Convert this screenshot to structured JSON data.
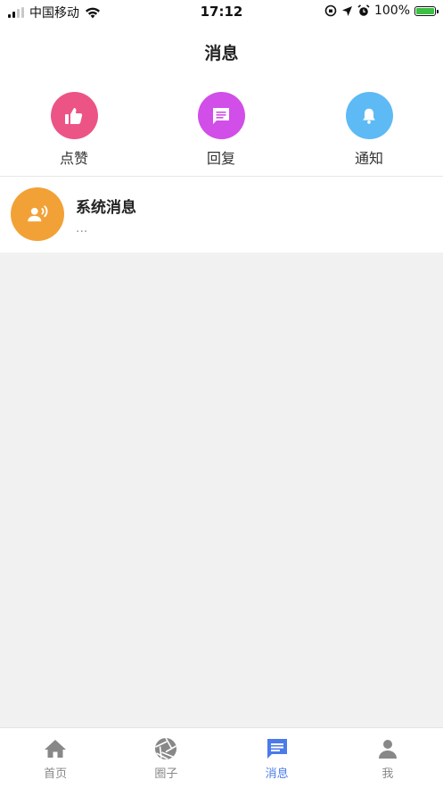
{
  "status_bar": {
    "carrier": "中国移动",
    "time": "17:12",
    "battery": "100%"
  },
  "header": {
    "title": "消息"
  },
  "shortcuts": [
    {
      "label": "点赞",
      "icon": "thumbs-up-icon",
      "color": "#ec5486"
    },
    {
      "label": "回复",
      "icon": "comment-icon",
      "color": "#d14ee8"
    },
    {
      "label": "通知",
      "icon": "bell-icon",
      "color": "#5dbaf5"
    }
  ],
  "messages": [
    {
      "title": "系统消息",
      "preview": "...",
      "icon": "announcement-icon",
      "color": "#f2a136"
    }
  ],
  "tabbar": {
    "active_color": "#4b7bea",
    "inactive_color": "#888888",
    "items": [
      {
        "label": "首页",
        "icon": "home-icon",
        "active": false
      },
      {
        "label": "圈子",
        "icon": "aperture-icon",
        "active": false
      },
      {
        "label": "消息",
        "icon": "message-icon",
        "active": true
      },
      {
        "label": "我",
        "icon": "user-icon",
        "active": false
      }
    ]
  }
}
